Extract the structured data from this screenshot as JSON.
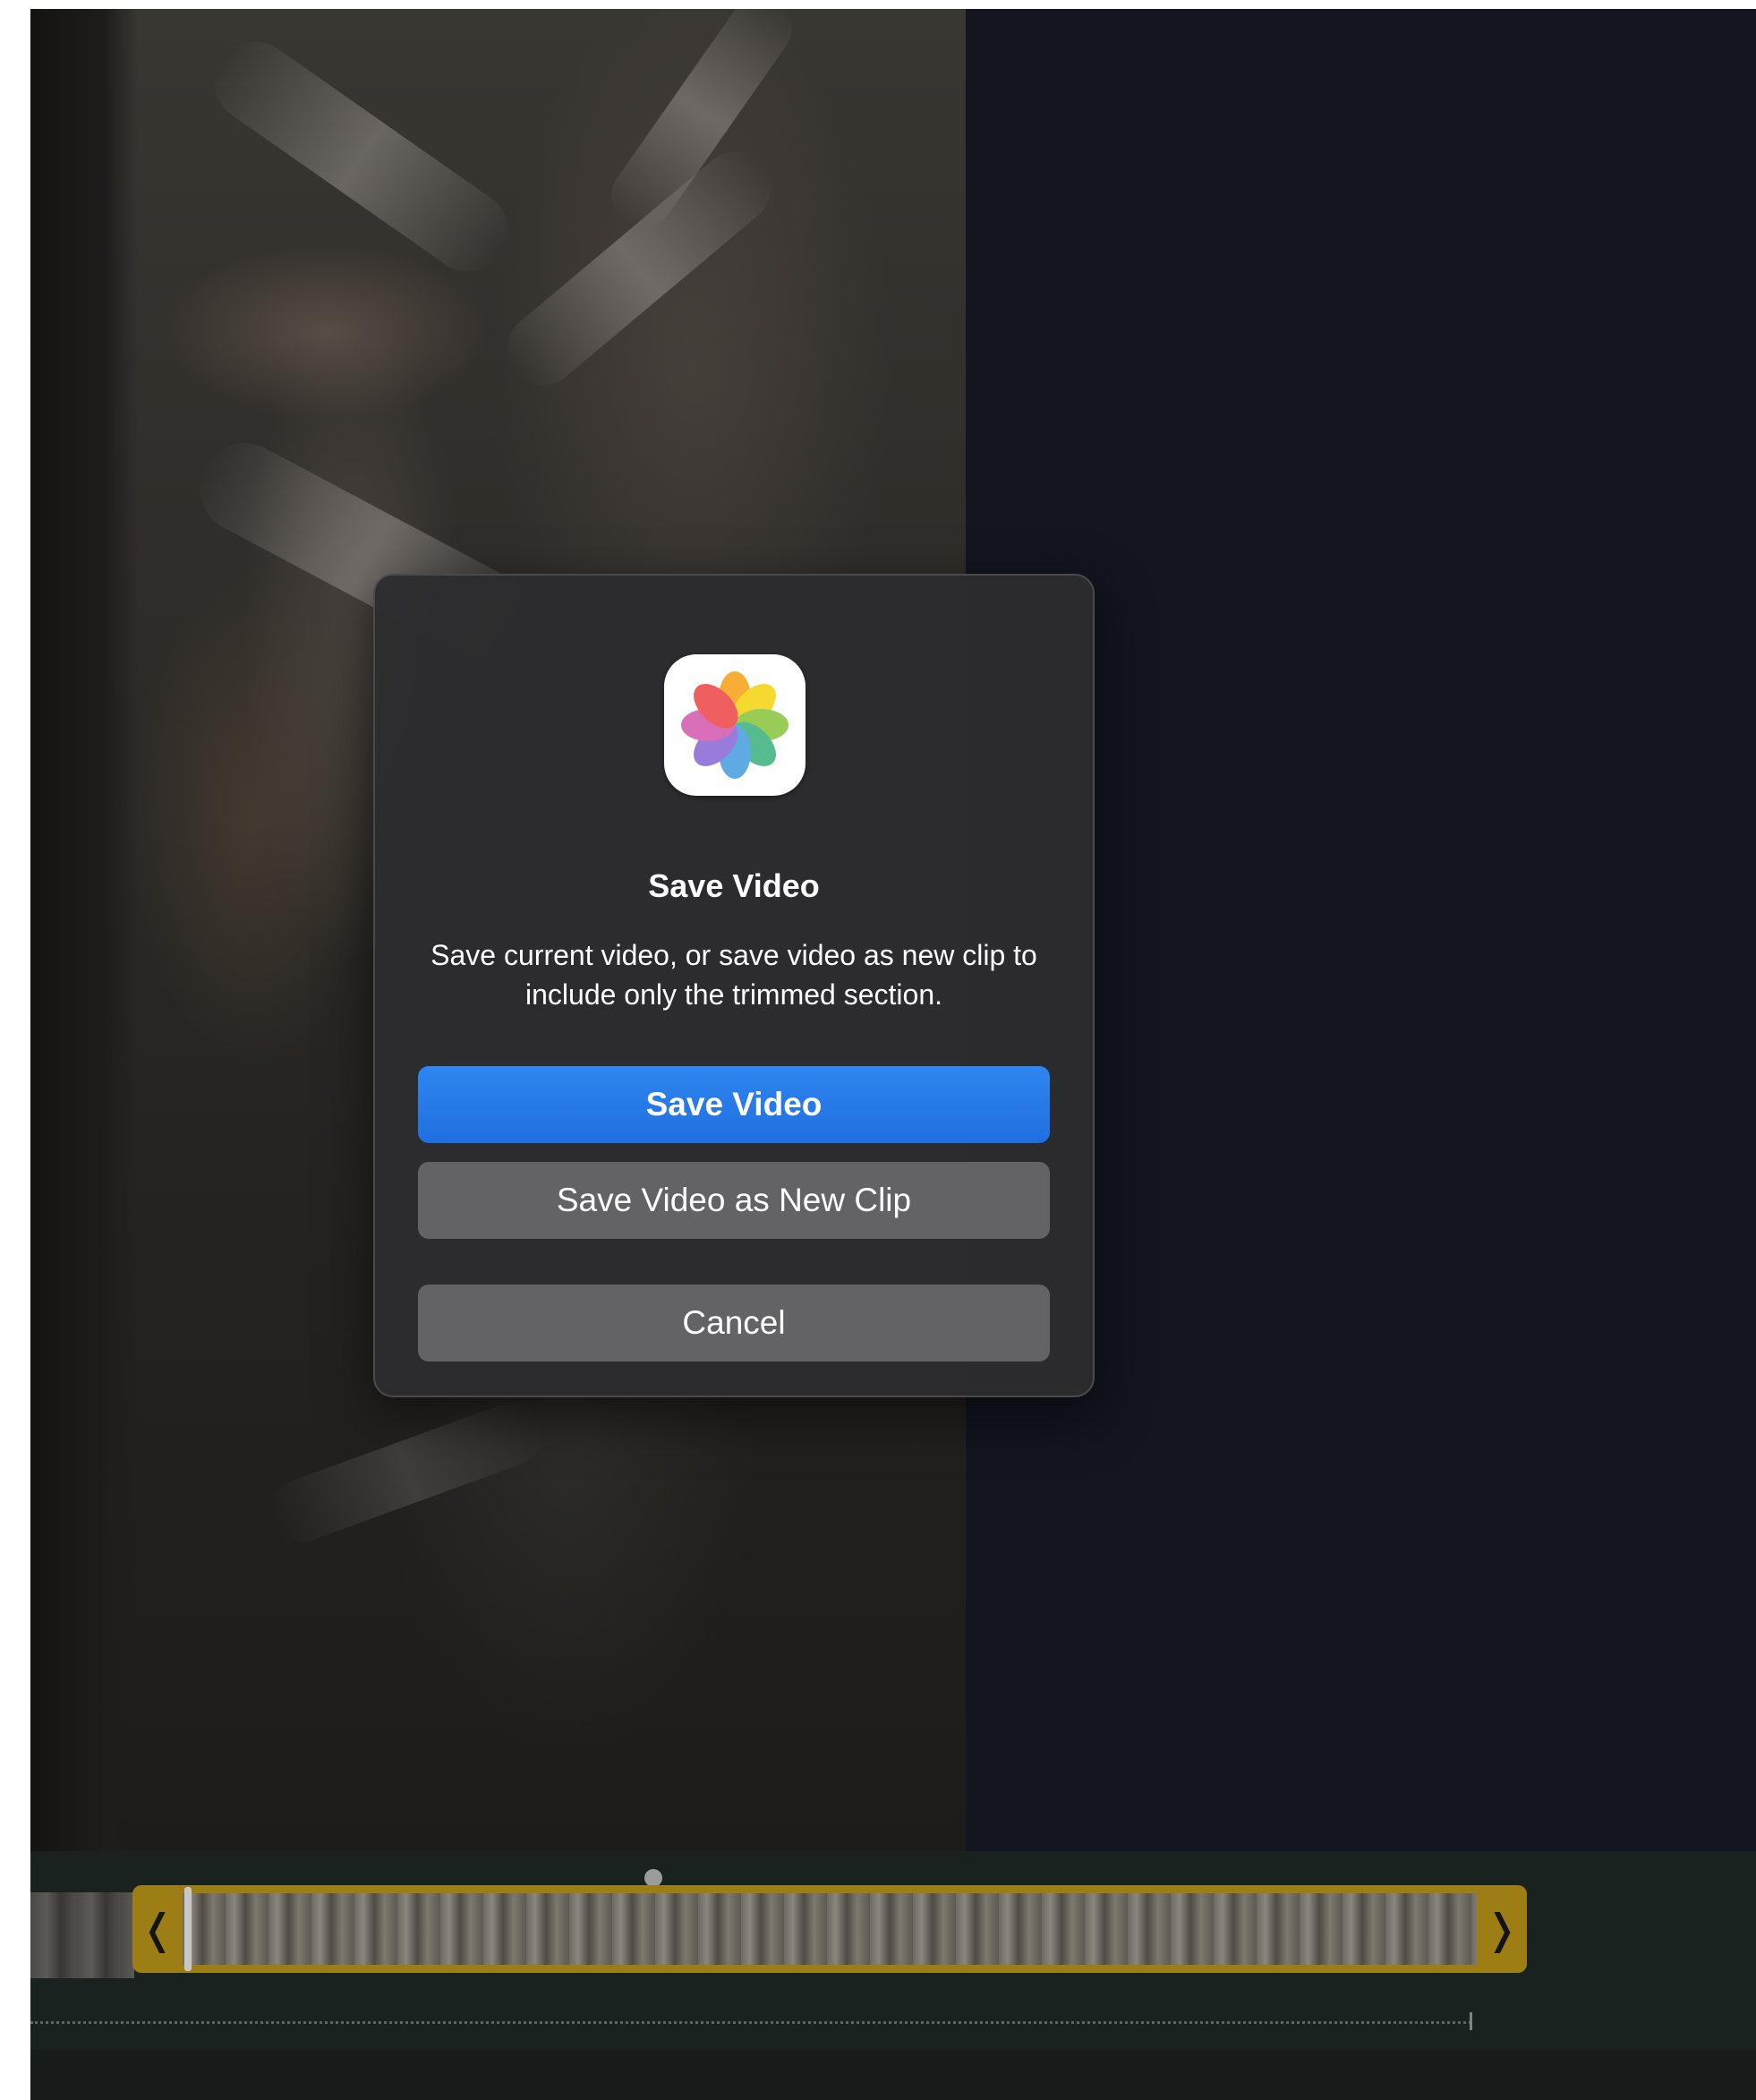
{
  "dialog": {
    "icon": "photos-app-icon",
    "title": "Save Video",
    "message": "Save current video, or save video as new clip to include only the trimmed section.",
    "buttons": {
      "save": "Save Video",
      "save_clip": "Save Video as New Clip",
      "cancel": "Cancel"
    }
  },
  "timeline": {
    "trim_left_glyph": "❬",
    "trim_right_glyph": "❭"
  },
  "colors": {
    "accent": "#1f6fe0",
    "trim_frame": "#9c7e14",
    "secondary_button": "#636366"
  }
}
